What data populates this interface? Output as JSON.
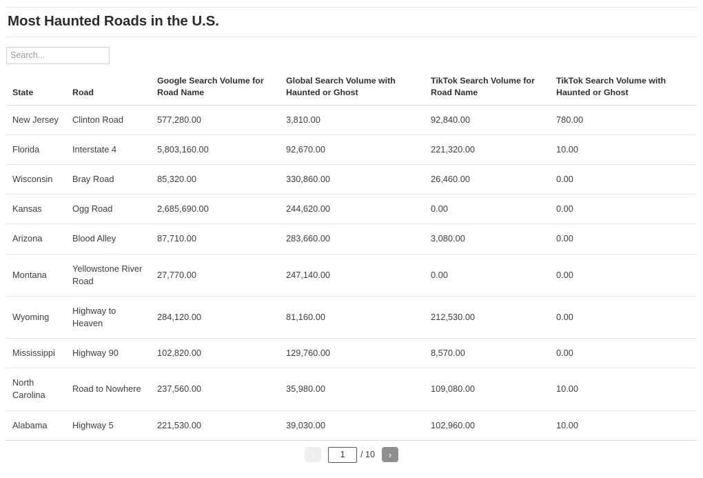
{
  "page": {
    "title": "Most Haunted Roads in the U.S."
  },
  "search": {
    "placeholder": "Search...",
    "value": ""
  },
  "table": {
    "columns": [
      "State",
      "Road",
      "Google Search Volume for Road Name",
      "Global Search Volume with Haunted or Ghost",
      "TikTok Search Volume for Road Name",
      "TikTok Search Volume with Haunted or Ghost"
    ],
    "rows": [
      {
        "state": "New Jersey",
        "road": "Clinton Road",
        "google_road": "577,280.00",
        "global_haunted": "3,810.00",
        "tiktok_road": "92,840.00",
        "tiktok_haunted": "780.00"
      },
      {
        "state": "Florida",
        "road": "Interstate 4",
        "google_road": "5,803,160.00",
        "global_haunted": "92,670.00",
        "tiktok_road": "221,320.00",
        "tiktok_haunted": "10.00"
      },
      {
        "state": "Wisconsin",
        "road": "Bray Road",
        "google_road": "85,320.00",
        "global_haunted": "330,860.00",
        "tiktok_road": "26,460.00",
        "tiktok_haunted": "0.00"
      },
      {
        "state": "Kansas",
        "road": "Ogg Road",
        "google_road": "2,685,690.00",
        "global_haunted": "244,620.00",
        "tiktok_road": "0.00",
        "tiktok_haunted": "0.00"
      },
      {
        "state": "Arizona",
        "road": "Blood Alley",
        "google_road": "87,710.00",
        "global_haunted": "283,660.00",
        "tiktok_road": "3,080.00",
        "tiktok_haunted": "0.00"
      },
      {
        "state": "Montana",
        "road": "Yellowstone River Road",
        "google_road": "27,770.00",
        "global_haunted": "247,140.00",
        "tiktok_road": "0.00",
        "tiktok_haunted": "0.00"
      },
      {
        "state": "Wyoming",
        "road": "Highway to Heaven",
        "google_road": "284,120.00",
        "global_haunted": "81,160.00",
        "tiktok_road": "212,530.00",
        "tiktok_haunted": "0.00"
      },
      {
        "state": "Mississippi",
        "road": "Highway 90",
        "google_road": "102,820.00",
        "global_haunted": "129,760.00",
        "tiktok_road": "8,570.00",
        "tiktok_haunted": "0.00"
      },
      {
        "state": "North Carolina",
        "road": "Road to Nowhere",
        "google_road": "237,560.00",
        "global_haunted": "35,980.00",
        "tiktok_road": "109,080.00",
        "tiktok_haunted": "10.00"
      },
      {
        "state": "Alabama",
        "road": "Highway 5",
        "google_road": "221,530.00",
        "global_haunted": "39,030.00",
        "tiktok_road": "102,960.00",
        "tiktok_haunted": "10.00"
      }
    ]
  },
  "pagination": {
    "prev_label": "‹",
    "next_label": "›",
    "current_page": "1",
    "total_pages_label": "/ 10"
  }
}
